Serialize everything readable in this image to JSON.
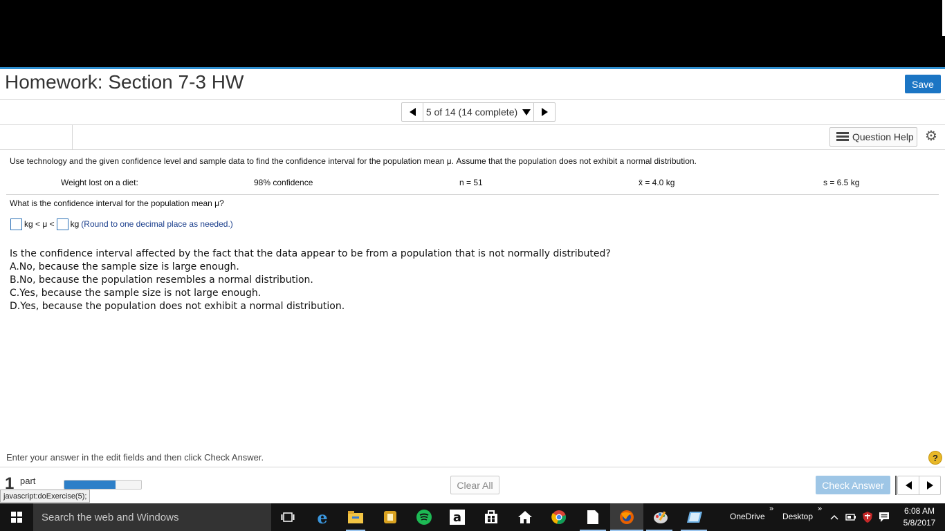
{
  "header": {
    "title": "Homework: Section 7-3 HW",
    "save_label": "Save"
  },
  "nav": {
    "position_label": "5 of 14 (14 complete)"
  },
  "toolbar": {
    "question_help_label": "Question Help"
  },
  "question": {
    "intro": "Use technology and the given confidence level and sample data to find the confidence interval for the population mean μ. Assume that the population does not exhibit a normal distribution.",
    "data": {
      "label": "Weight lost on a diet:",
      "confidence": "98% confidence",
      "n": "n = 51",
      "xbar": "x̄ = 4.0 kg",
      "s": "s = 6.5 kg"
    },
    "ci_prompt": "What is the confidence interval for the population mean μ?",
    "ci_answer": {
      "lower_value": "",
      "middle_text": "kg < μ <",
      "unit_text": "kg",
      "note": "(Round to one decimal place as needed.)"
    },
    "mc_prompt": "Is the confidence interval affected by the fact that the data appear to be from a population that is not normally distributed?",
    "mc_options": [
      "A.No, because the sample size is large enough.",
      "B.No, because the population resembles a normal distribution.",
      "C.Yes, because the sample size is not large enough.",
      "D.Yes, because the population does not exhibit a normal distribution."
    ]
  },
  "footer": {
    "instruction": "Enter your answer in the edit fields and then click Check Answer.",
    "help_symbol": "?",
    "part_number": "1",
    "part_label": "part",
    "progress_fraction": 0.67,
    "clear_all_label": "Clear All",
    "check_answer_label": "Check Answer"
  },
  "browser": {
    "status_text": "javascript:doExercise(5);"
  },
  "taskbar": {
    "search_placeholder": "Search the web and Windows",
    "onedrive_label": "OneDrive",
    "desktop_label": "Desktop",
    "chevron": "»",
    "time": "6:08 AM",
    "date": "5/8/2017",
    "amazon_letter": "a"
  },
  "colors": {
    "accent_blue": "#1b75c4",
    "header_line": "#2e8fd0",
    "check_answer_disabled": "#9ec6e6",
    "help_yellow": "#e8b828"
  }
}
